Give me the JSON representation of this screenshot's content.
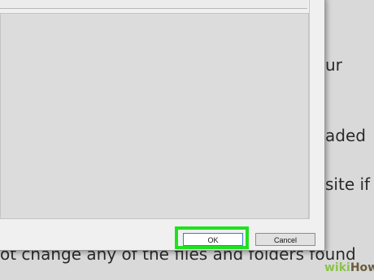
{
  "background_text": {
    "right_line_1": "ur",
    "right_line_2": "aded",
    "right_line_3": "site if",
    "bottom_line": "ot change any of the files and folders found"
  },
  "dialog": {
    "ok_label": "OK",
    "cancel_label": "Cancel"
  },
  "watermark": {
    "part1": "wiki",
    "part2": "How"
  },
  "colors": {
    "highlight": "#1fe21f",
    "dialog_bg": "#f0f0f0",
    "list_bg": "#dcdcdc",
    "watermark_wiki": "#8cc34a",
    "watermark_how": "#6b5b3e"
  }
}
